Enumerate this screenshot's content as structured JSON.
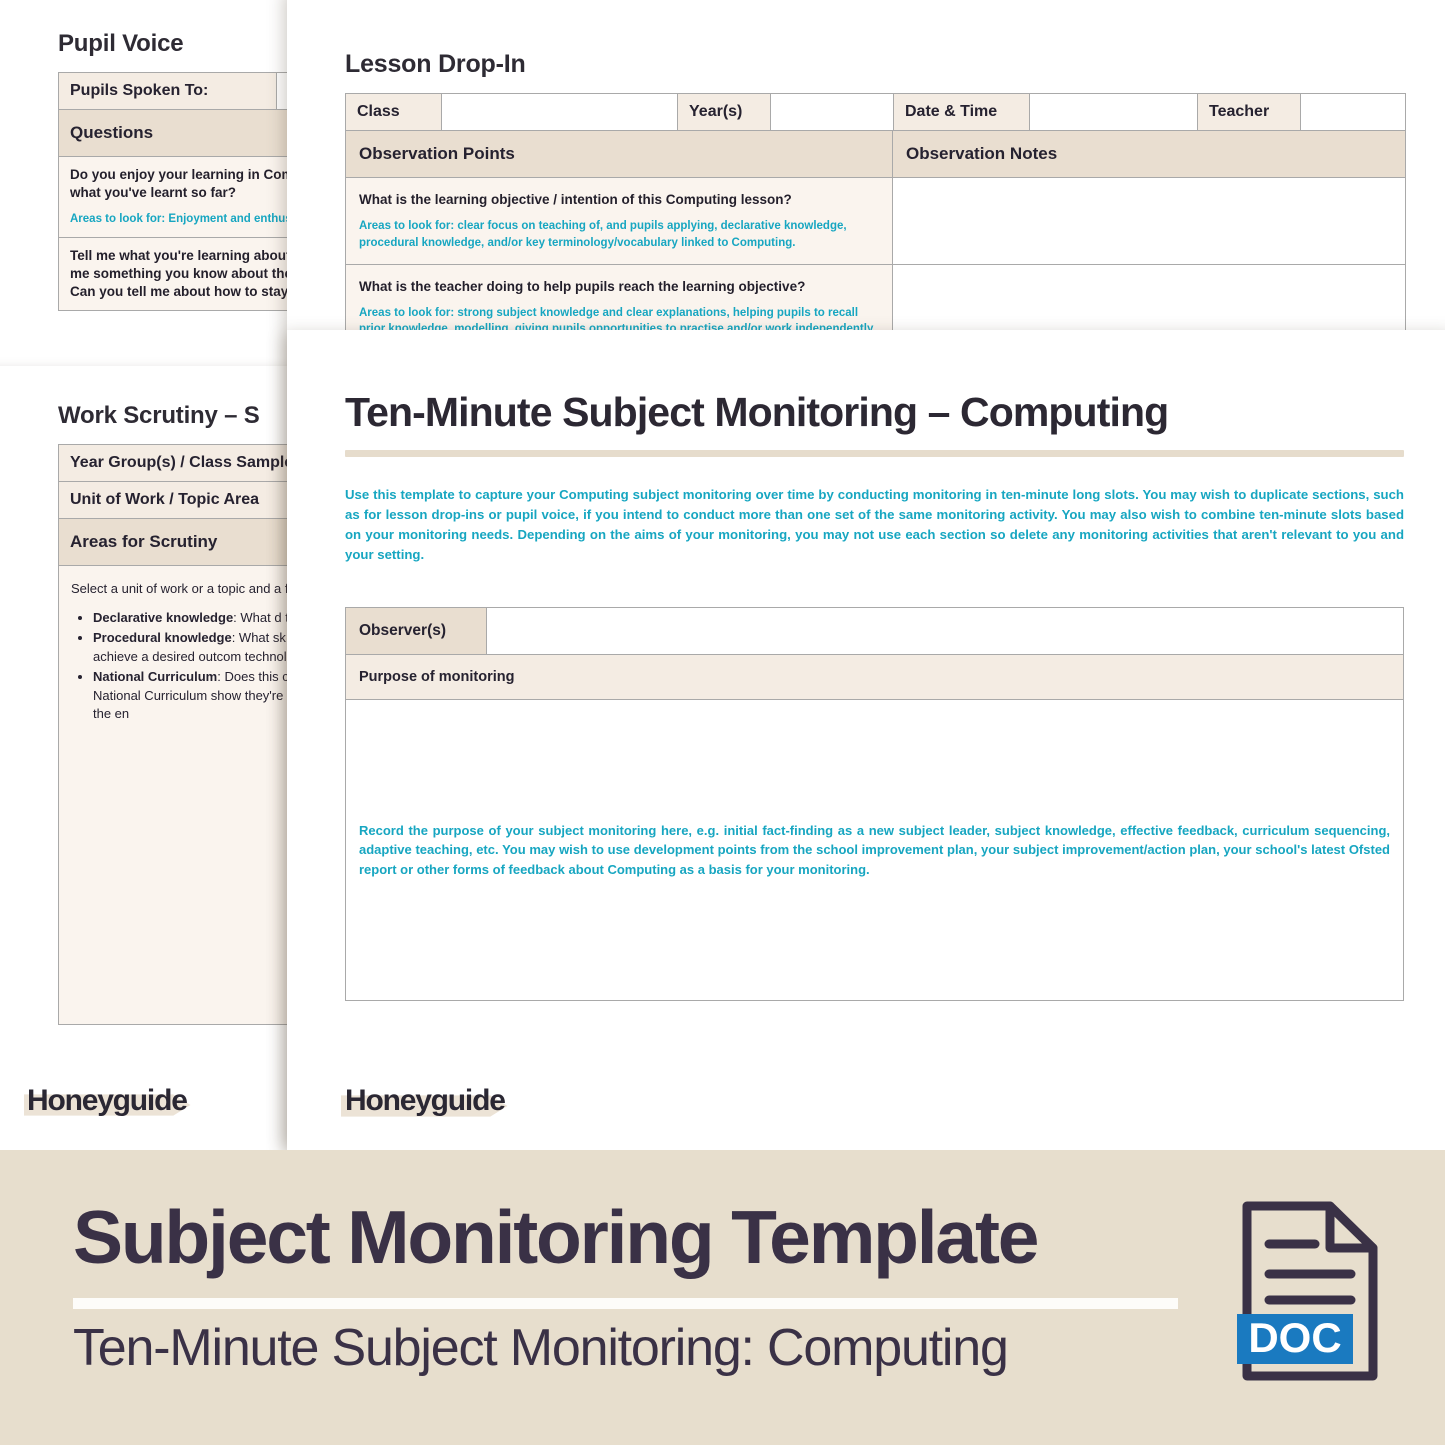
{
  "colors": {
    "accent_teal": "#17a6c1",
    "header_beige": "#e9ded0",
    "label_beige": "#f4ece3",
    "banner_beige": "#e7decd",
    "ink": "#2c2833",
    "doc_blue": "#1a7ac0"
  },
  "pupil_voice": {
    "heading": "Pupil Voice",
    "rows": [
      {
        "label": "Pupils Spoken To:",
        "value": ""
      },
      {
        "label": "Questions",
        "value": ""
      }
    ],
    "questions": [
      {
        "text": "Do you enjoy your learning in Computing? What have you enjoyed about what you've learnt so far?",
        "hint": "Areas to look for: Enjoyment and enthusiasm"
      },
      {
        "text": "Tell me what you're learning about in Computing at the moment. Can you tell me something you know about the internet? How does the internet work? Can you tell me about how to stay safe on the internet?"
      }
    ]
  },
  "work_scrutiny": {
    "heading": "Work Scrutiny – S",
    "rows": [
      {
        "label": "Year Group(s) / Class Sampled",
        "value": ""
      },
      {
        "label": "Unit of Work / Topic Area",
        "value": ""
      },
      {
        "label": "Areas for Scrutiny",
        "value": ""
      }
    ],
    "intro": "Select a unit of work or a topic and a following:",
    "bullets": [
      {
        "lead": "Declarative knowledge",
        "text": ": What d that') of Computing have pupils a"
      },
      {
        "lead": "Procedural knowledge",
        "text": ": What sk pupils learning how to do in Com skills to achieve a desired outcom technology?"
      },
      {
        "lead": "National Curriculum",
        "text": ": Does this content for the relevant statemen (i.e. is there National Curriculum show they're working towards me the National Curriculum at the en"
      }
    ]
  },
  "lesson_dropin": {
    "heading": "Lesson Drop-In",
    "meta": [
      {
        "label": "Class",
        "value": ""
      },
      {
        "label": "Year(s)",
        "value": ""
      },
      {
        "label": "Date & Time",
        "value": ""
      },
      {
        "label": "Teacher",
        "value": ""
      }
    ],
    "col_headers": [
      "Observation Points",
      "Observation Notes"
    ],
    "points": [
      {
        "question": "What is the learning objective / intention of this Computing lesson?",
        "hint": "Areas to look for: clear focus on teaching of, and pupils applying, declarative knowledge, procedural knowledge, and/or key terminology/vocabulary linked to Computing.",
        "notes": ""
      },
      {
        "question": "What is the teacher doing to help pupils reach the learning objective?",
        "hint": "Areas to look for: strong subject knowledge and clear explanations, helping pupils to recall prior knowledge, modelling, giving pupils opportunities to practise and/or work independently, addressing",
        "notes": ""
      }
    ]
  },
  "main": {
    "title": "Ten-Minute Subject Monitoring – Computing",
    "intro": "Use this template to capture your Computing subject monitoring over time by conducting monitoring in ten-minute long slots. You may wish to duplicate sections, such as for lesson drop-ins or pupil voice, if you intend to conduct more than one set of the same monitoring activity. You may also wish to combine ten-minute slots based on your monitoring needs. Depending on the aims of your monitoring, you may not use each section so delete any monitoring activities that aren't relevant to you and your setting.",
    "observer_label": "Observer(s)",
    "observer_value": "",
    "purpose_label": "Purpose of monitoring",
    "purpose_hint": "Record the purpose of your subject monitoring here, e.g. initial fact-finding as a new subject leader, subject knowledge, effective feedback, curriculum sequencing, adaptive teaching, etc. You may wish to use development points from the school improvement plan, your subject improvement/action plan, your school's latest Ofsted report or other forms of feedback about Computing as a basis for your monitoring.",
    "purpose_value": ""
  },
  "logo": {
    "text": "Honeyguide"
  },
  "banner": {
    "title": "Subject Monitoring Template",
    "subtitle": "Ten-Minute Subject Monitoring: Computing",
    "file_type": "DOC"
  }
}
